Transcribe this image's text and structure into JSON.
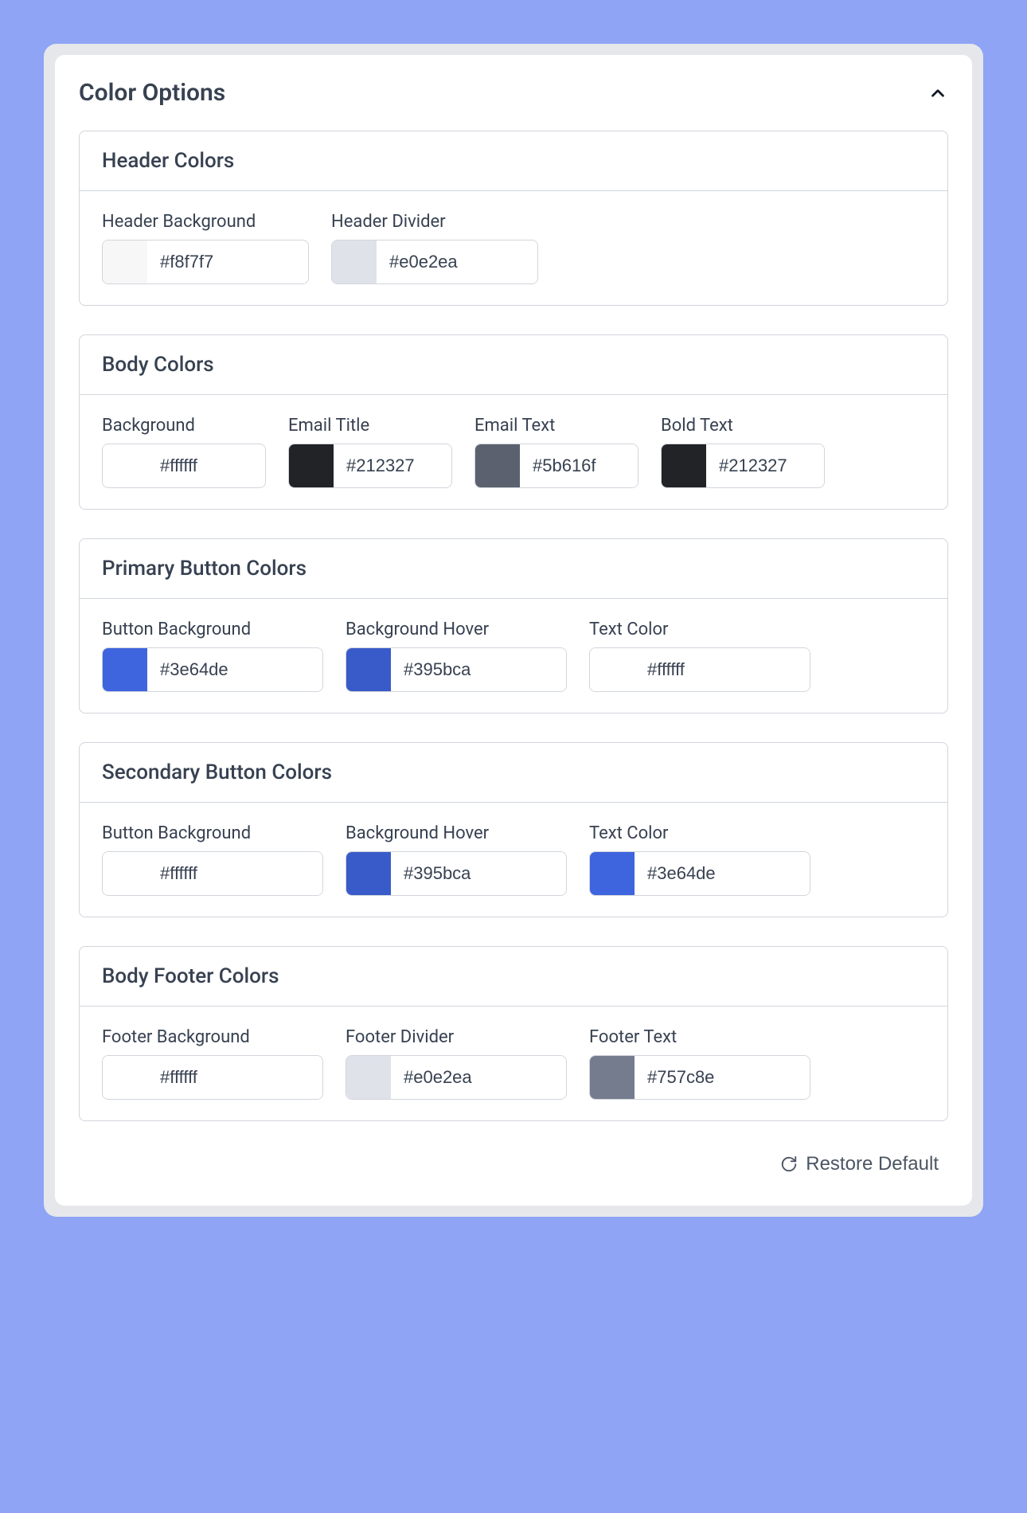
{
  "page": {
    "title": "Color Options",
    "restore_label": "Restore Default"
  },
  "sections": [
    {
      "id": "header-colors",
      "title": "Header Colors",
      "fields": [
        {
          "id": "header-background",
          "label": "Header Background",
          "value": "#f8f7f7"
        },
        {
          "id": "header-divider",
          "label": "Header Divider",
          "value": "#e0e2ea"
        }
      ]
    },
    {
      "id": "body-colors",
      "title": "Body Colors",
      "fields": [
        {
          "id": "body-background",
          "label": "Background",
          "value": "#ffffff"
        },
        {
          "id": "email-title",
          "label": "Email Title",
          "value": "#212327"
        },
        {
          "id": "email-text",
          "label": "Email Text",
          "value": "#5b616f"
        },
        {
          "id": "bold-text",
          "label": "Bold Text",
          "value": "#212327"
        }
      ]
    },
    {
      "id": "primary-button-colors",
      "title": "Primary Button Colors",
      "fields": [
        {
          "id": "primary-btn-bg",
          "label": "Button Background",
          "value": "#3e64de"
        },
        {
          "id": "primary-btn-hover",
          "label": "Background Hover",
          "value": "#395bca"
        },
        {
          "id": "primary-btn-text",
          "label": "Text Color",
          "value": "#ffffff"
        }
      ]
    },
    {
      "id": "secondary-button-colors",
      "title": "Secondary Button Colors",
      "fields": [
        {
          "id": "secondary-btn-bg",
          "label": "Button Background",
          "value": "#ffffff"
        },
        {
          "id": "secondary-btn-hover",
          "label": "Background Hover",
          "value": "#395bca"
        },
        {
          "id": "secondary-btn-text",
          "label": "Text Color",
          "value": "#3e64de"
        }
      ]
    },
    {
      "id": "body-footer-colors",
      "title": "Body Footer Colors",
      "fields": [
        {
          "id": "footer-bg",
          "label": "Footer Background",
          "value": "#ffffff"
        },
        {
          "id": "footer-divider",
          "label": "Footer Divider",
          "value": "#e0e2ea"
        },
        {
          "id": "footer-text",
          "label": "Footer Text",
          "value": "#757c8e"
        }
      ]
    }
  ]
}
